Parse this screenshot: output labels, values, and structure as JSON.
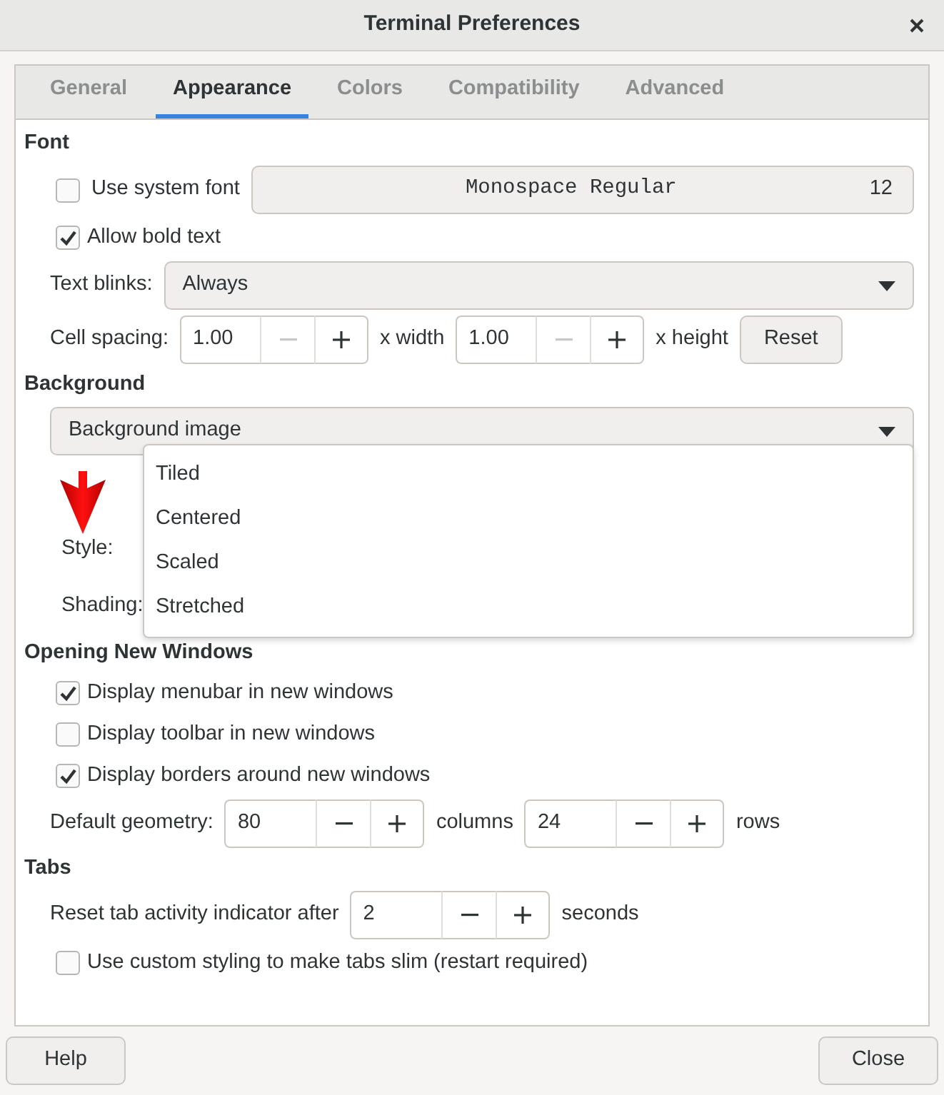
{
  "window": {
    "title": "Terminal Preferences"
  },
  "tabs": [
    {
      "label": "General",
      "selected": false
    },
    {
      "label": "Appearance",
      "selected": true
    },
    {
      "label": "Colors",
      "selected": false
    },
    {
      "label": "Compatibility",
      "selected": false
    },
    {
      "label": "Advanced",
      "selected": false
    }
  ],
  "sections": [
    {
      "heading": "Font",
      "rows": [
        {
          "kind": "check-font",
          "label": "Use system font",
          "checked": false,
          "font_name": "Monospace Regular",
          "font_size": "12"
        },
        {
          "kind": "check",
          "label": "Allow bold text",
          "checked": true
        },
        {
          "kind": "select",
          "label": "Text blinks:",
          "value": "Always"
        },
        {
          "kind": "spins",
          "label": "Cell spacing:",
          "spins": [
            {
              "value": "1.00",
              "minus_disabled": true,
              "unit": "x width"
            },
            {
              "value": "1.00",
              "minus_disabled": true,
              "unit": "x height"
            }
          ],
          "button": "Reset"
        }
      ]
    },
    {
      "heading": "Background",
      "rows": [
        {
          "kind": "select",
          "value": "Background image"
        },
        {
          "kind": "label",
          "label": "Style:"
        },
        {
          "kind": "label",
          "label": "Shading:"
        }
      ]
    },
    {
      "heading": "Opening New Windows",
      "rows": [
        {
          "kind": "check",
          "label": "Display menubar in new windows",
          "checked": true
        },
        {
          "kind": "check",
          "label": "Display toolbar in new windows",
          "checked": false
        },
        {
          "kind": "check",
          "label": "Display borders around new windows",
          "checked": true
        },
        {
          "kind": "spins",
          "label": "Default geometry:",
          "spins": [
            {
              "value": "80",
              "minus_disabled": false,
              "unit": "columns"
            },
            {
              "value": "24",
              "minus_disabled": false,
              "unit": "rows"
            }
          ]
        }
      ]
    },
    {
      "heading": "Tabs",
      "rows": [
        {
          "kind": "spins",
          "label": "Reset tab activity indicator after",
          "spins": [
            {
              "value": "2",
              "minus_disabled": false,
              "unit": "seconds"
            }
          ]
        },
        {
          "kind": "check",
          "label": "Use custom styling to make tabs slim (restart required)",
          "checked": false
        }
      ]
    }
  ],
  "dropdown_menu": {
    "items": [
      "Tiled",
      "Centered",
      "Scaled",
      "Stretched"
    ]
  },
  "buttons": [
    "Help",
    "Close"
  ]
}
